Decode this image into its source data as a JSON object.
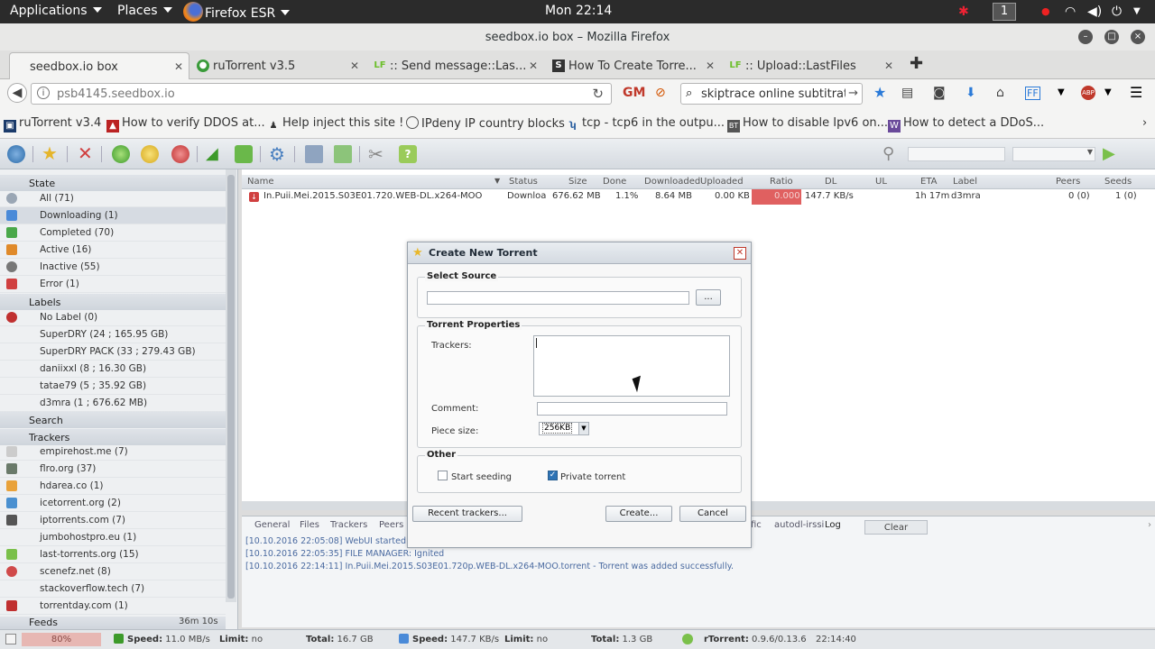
{
  "system_bar": {
    "applications": "Applications",
    "places": "Places",
    "browser": "Firefox ESR",
    "clock": "Mon 22:14",
    "workspace": "1"
  },
  "window": {
    "title": "seedbox.io box – Mozilla Firefox"
  },
  "tabs": [
    {
      "label": "seedbox.io box",
      "active": true
    },
    {
      "label": "ruTorrent v3.5",
      "active": false
    },
    {
      "label": ":: Send message::Las...",
      "active": false
    },
    {
      "label": "How To Create Torre...",
      "active": false
    },
    {
      "label": ":: Upload::LastFiles",
      "active": false
    }
  ],
  "nav": {
    "url": "psb4145.seedbox.io",
    "search": "skiptrace online subtitrat"
  },
  "bookmarks": [
    "ruTorrent v3.4",
    "How to verify DDOS at...",
    "Help inject this site !",
    "IPdeny IP country blocks",
    "tcp - tcp6 in the outpu...",
    "How to disable Ipv6 on...",
    "How to detect a DDoS..."
  ],
  "sidebar": {
    "state_header": "State",
    "state_items": [
      "All (71)",
      "Downloading (1)",
      "Completed (70)",
      "Active (16)",
      "Inactive (55)",
      "Error (1)"
    ],
    "labels_header": "Labels",
    "label_items": [
      "No Label (0)",
      "SuperDRY (24 ; 165.95 GB)",
      "SuperDRY PACK (33 ; 279.43 GB)",
      "daniixxl (8 ; 16.30 GB)",
      "tatae79 (5 ; 35.92 GB)",
      "d3mra (1 ; 676.62 MB)"
    ],
    "search_header": "Search",
    "trackers_header": "Trackers",
    "tracker_items": [
      "empirehost.me (7)",
      "flro.org (37)",
      "hdarea.co (1)",
      "icetorrent.org (2)",
      "iptorrents.com (7)",
      "jumbohostpro.eu (1)",
      "last-torrents.org (15)",
      "scenefz.net (8)",
      "stackoverflow.tech (7)",
      "torrentday.com (1)"
    ],
    "feeds_header": "Feeds",
    "feeds_tail": "36m 10s"
  },
  "list": {
    "columns": [
      "Name",
      "Status",
      "Size",
      "Done",
      "Downloaded",
      "Uploaded",
      "Ratio",
      "DL",
      "UL",
      "ETA",
      "Label",
      "Peers",
      "Seeds"
    ],
    "row": {
      "name": "In.Puii.Mei.2015.S03E01.720.WEB-DL.x264-MOO",
      "status": "Downloa",
      "size": "676.62 MB",
      "done": "1.1%",
      "downloaded": "8.64 MB",
      "uploaded": "0.00 KB",
      "ratio": "0.000",
      "dl": "147.7 KB/s",
      "ul": "",
      "eta": "1h 17m",
      "label": "d3mra",
      "peers": "0 (0)",
      "seeds": "1 (0)"
    }
  },
  "log": {
    "tabs": [
      "General",
      "Files",
      "Trackers",
      "Peers",
      "fic",
      "autodl-irssi",
      "Log"
    ],
    "clear": "Clear",
    "lines": [
      "[10.10.2016 22:05:08] WebUI started.",
      "[10.10.2016 22:05:35] FILE MANAGER: Ignited",
      "[10.10.2016 22:14:11] In.Puii.Mei.2015.S03E01.720p.WEB-DL.x264-MOO.torrent - Torrent was added successfully."
    ]
  },
  "status": {
    "cpu": "80%",
    "speed_up_label": "Speed:",
    "speed_up": "11.0 MB/s",
    "limit_label": "Limit:",
    "limit_up": "no",
    "total_label": "Total:",
    "total_up": "16.7 GB",
    "speed_dl": "147.7 KB/s",
    "limit_dl": "no",
    "total_dl": "1.3 GB",
    "client": "rTorrent:",
    "client_ver": "0.9.6/0.13.6",
    "time": "22:14:40"
  },
  "dialog": {
    "title": "Create New Torrent",
    "select_source": "Select Source",
    "browse": "...",
    "torrent_properties": "Torrent Properties",
    "trackers_label": "Trackers:",
    "comment_label": "Comment:",
    "piece_size_label": "Piece size:",
    "piece_size": "256KB",
    "other": "Other",
    "start_seeding": "Start seeding",
    "private_torrent": "Private torrent",
    "recent_trackers": "Recent trackers...",
    "create": "Create...",
    "cancel": "Cancel"
  },
  "colors": {
    "ratio_bad": "#e06060",
    "gnome_bar": "#2b2b2b"
  }
}
